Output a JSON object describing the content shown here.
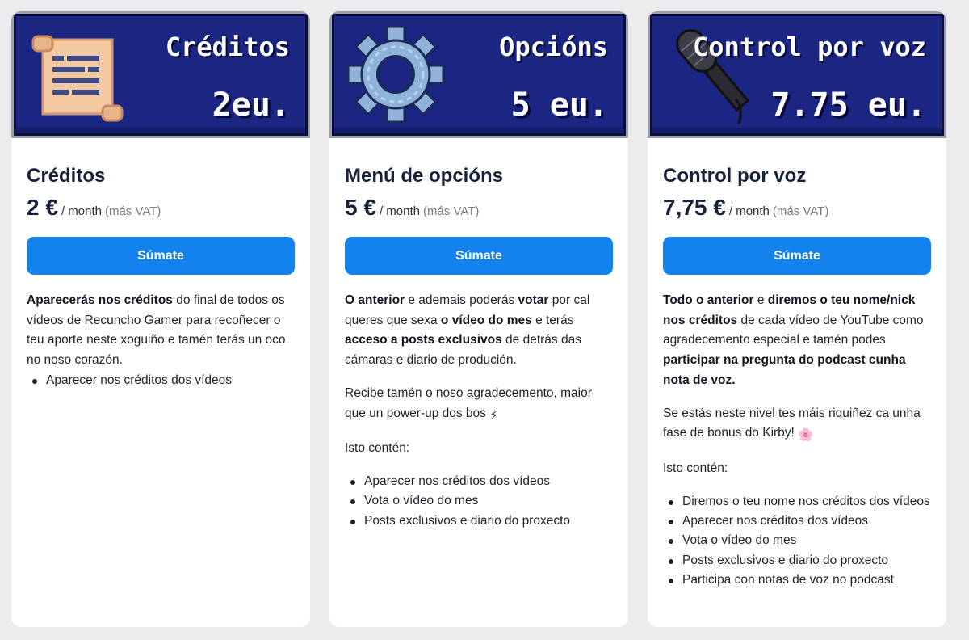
{
  "tiers": [
    {
      "banner_title": "Créditos",
      "banner_price": "2eu.",
      "banner_icon": "scroll-icon",
      "name": "Créditos",
      "price": "2 €",
      "period": "/ month",
      "vat": "(más VAT)",
      "button": "Súmate",
      "desc": [
        [
          {
            "t": "Aparecerás nos créditos",
            "b": true
          },
          {
            "t": " do final de todos os vídeos de Recuncho Gamer para recoñecer o teu aporte neste xoguiño e tamén terás un oco no noso corazón.",
            "b": false
          }
        ]
      ],
      "benefits_intro": "",
      "benefits": [
        "Aparecer nos créditos dos vídeos"
      ]
    },
    {
      "banner_title": "Opcións",
      "banner_price": "5 eu.",
      "banner_icon": "gear-icon",
      "name": "Menú de opcións",
      "price": "5 €",
      "period": "/ month",
      "vat": "(más VAT)",
      "button": "Súmate",
      "desc": [
        [
          {
            "t": "O anterior",
            "b": true
          },
          {
            "t": " e ademais poderás ",
            "b": false
          },
          {
            "t": "votar",
            "b": true
          },
          {
            "t": " por cal queres que sexa ",
            "b": false
          },
          {
            "t": "o vídeo do mes",
            "b": true
          },
          {
            "t": " e terás ",
            "b": false
          },
          {
            "t": "acceso a posts exclusivos",
            "b": true
          },
          {
            "t": " de detrás das cámaras e diario de produción.",
            "b": false
          }
        ],
        [
          {
            "t": "Recibe tamén o noso agradecemento, maior que un power-up dos bos ",
            "b": false
          },
          {
            "t": "⚡",
            "b": false,
            "emoji": "lightning-icon"
          }
        ]
      ],
      "benefits_intro": "Isto contén:",
      "benefits": [
        "Aparecer nos créditos dos vídeos",
        "Vota o vídeo do mes",
        "Posts exclusivos e diario do proxecto"
      ]
    },
    {
      "banner_title": "Control por voz",
      "banner_price": "7.75 eu.",
      "banner_icon": "microphone-icon",
      "name": "Control por voz",
      "price": "7,75 €",
      "period": "/ month",
      "vat": "(más VAT)",
      "button": "Súmate",
      "desc": [
        [
          {
            "t": "Todo o anterior",
            "b": true
          },
          {
            "t": " e ",
            "b": false
          },
          {
            "t": "diremos o teu nome/nick nos créditos",
            "b": true
          },
          {
            "t": " de cada vídeo de YouTube como agradecemento especial e tamén podes ",
            "b": false
          },
          {
            "t": "participar na pregunta do podcast cunha nota de voz.",
            "b": true
          }
        ],
        [
          {
            "t": "Se estás neste nivel tes máis riquiñez ca unha fase de bonus do Kirby! ",
            "b": false
          },
          {
            "t": "🌸",
            "b": false,
            "emoji": "flower-icon"
          }
        ]
      ],
      "benefits_intro": "Isto contén:",
      "benefits": [
        "Diremos o teu nome nos créditos dos vídeos",
        "Aparecer nos créditos dos vídeos",
        "Vota o vídeo do mes",
        "Posts exclusivos e diario do proxecto",
        "Participa con notas de voz no podcast"
      ]
    }
  ],
  "colors": {
    "page_bg": "#ececee",
    "banner_bg": "#1b2582",
    "button_bg": "#1482ec",
    "card_bg": "#ffffff"
  }
}
